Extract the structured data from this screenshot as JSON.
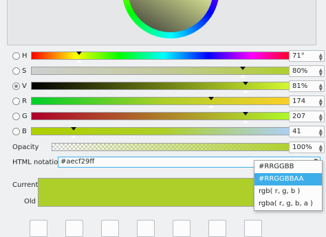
{
  "channels": [
    {
      "label": "H",
      "value": "71°",
      "pos": 0.18,
      "selected": false,
      "gradient": "linear-gradient(to right,#ff0000,#ffff00,#00ff00,#00ffff,#0000ff,#ff00ff,#ff0000)"
    },
    {
      "label": "S",
      "value": "80%",
      "pos": 0.8,
      "selected": false,
      "gradient": "linear-gradient(to right,#cfcfcf,#c3c99b,#aecf29)"
    },
    {
      "label": "V",
      "value": "81%",
      "pos": 0.81,
      "selected": true,
      "gradient": "linear-gradient(to right,#000000,#6d7e14,#d9ff33)"
    },
    {
      "label": "R",
      "value": "174",
      "pos": 0.68,
      "selected": false,
      "gradient": "linear-gradient(to right,#00cf29,#aecf29,#ffcf29)"
    },
    {
      "label": "G",
      "value": "207",
      "pos": 0.81,
      "selected": false,
      "gradient": "linear-gradient(to right,#ae0029,#ae8029,#aeff29)"
    },
    {
      "label": "B",
      "value": "41",
      "pos": 0.16,
      "selected": false,
      "gradient": "linear-gradient(to right,#aecf00,#aecf29,#aecfff)"
    }
  ],
  "opacity": {
    "label": "Opacity",
    "value": "100%",
    "pos": 1.0
  },
  "html_notation": {
    "label": "HTML notation",
    "value": "#aecf29ff"
  },
  "current_label": "Current",
  "old_label": "Old",
  "current_color": "#aecf29",
  "format_options": [
    {
      "label": "#RRGGBB",
      "selected": false
    },
    {
      "label": "#RRGGBBAA",
      "selected": true
    },
    {
      "label": "rgb( r, g, b )",
      "selected": false
    },
    {
      "label": "rgba( r, g, b, a )",
      "selected": false
    }
  ],
  "custom_color_slots": 7
}
